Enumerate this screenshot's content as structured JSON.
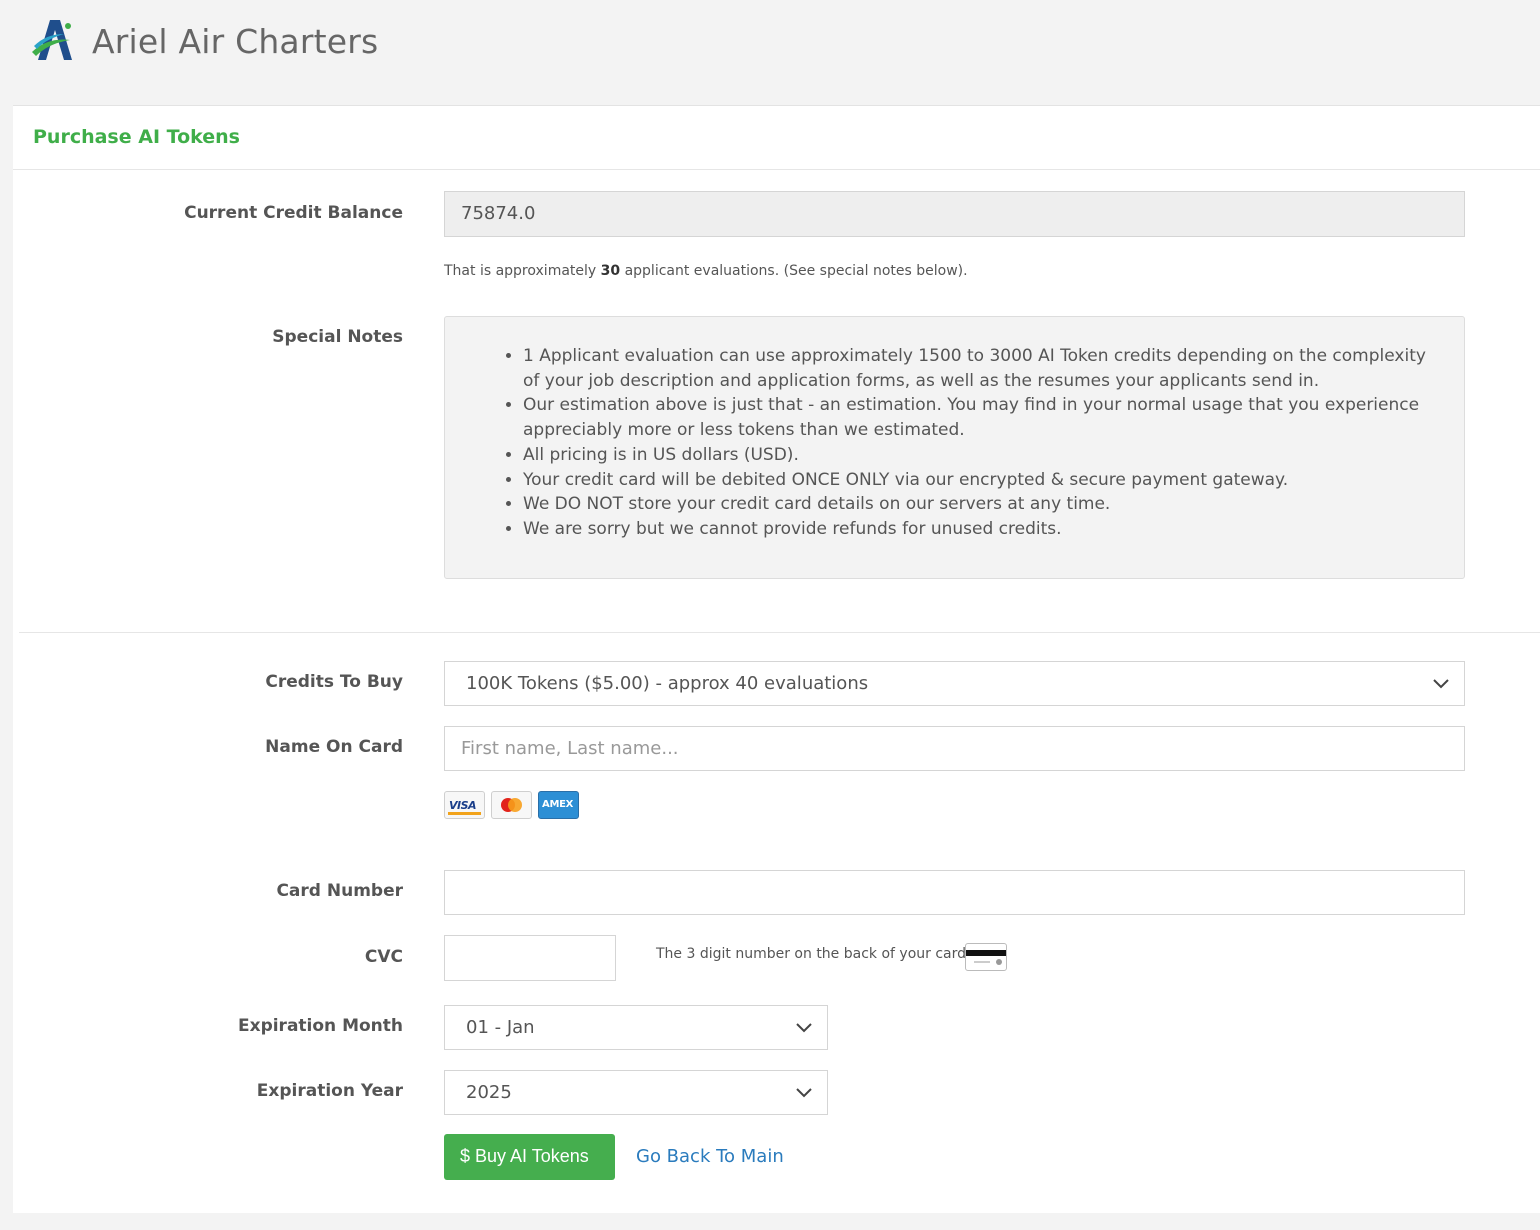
{
  "header": {
    "brand": "Ariel Air Charters"
  },
  "panel": {
    "title": "Purchase AI Tokens"
  },
  "balance": {
    "label": "Current Credit Balance",
    "value": "75874.0",
    "help_prefix": "That is approximately ",
    "help_bold": "30",
    "help_suffix": " applicant evaluations. (See special notes below)."
  },
  "special_notes": {
    "label": "Special Notes",
    "items": [
      "1 Applicant evaluation can use approximately 1500 to 3000 AI Token credits depending on the complexity of your job description and application forms, as well as the resumes your applicants send in.",
      "Our estimation above is just that - an estimation. You may find in your normal usage that you experience appreciably more or less tokens than we estimated.",
      "All pricing is in US dollars (USD).",
      "Your credit card will be debited ONCE ONLY via our encrypted & secure payment gateway.",
      "We DO NOT store your credit card details on our servers at any time.",
      "We are sorry but we cannot provide refunds for unused credits."
    ]
  },
  "form": {
    "credits_label": "Credits To Buy",
    "credits_selected": "100K Tokens ($5.00) - approx 40 evaluations",
    "name_label": "Name On Card",
    "name_value": "",
    "name_placeholder": "First name, Last name...",
    "card_icons": [
      "visa-card-icon",
      "mastercard-icon",
      "amex-card-icon"
    ],
    "visa_text": "VISA",
    "amex_text": "AMEX",
    "card_number_label": "Card Number",
    "card_number_value": "",
    "cvc_label": "CVC",
    "cvc_value": "",
    "cvc_help": "The 3 digit number on the back of your card.",
    "exp_month_label": "Expiration Month",
    "exp_month_selected": "01 - Jan",
    "exp_year_label": "Expiration Year",
    "exp_year_selected": "2025"
  },
  "actions": {
    "buy_label": "$ Buy AI Tokens",
    "back_label": "Go Back To Main"
  },
  "colors": {
    "accent_green": "#45ae4e",
    "title_green": "#3fae49",
    "link_blue": "#2a7bbd"
  }
}
